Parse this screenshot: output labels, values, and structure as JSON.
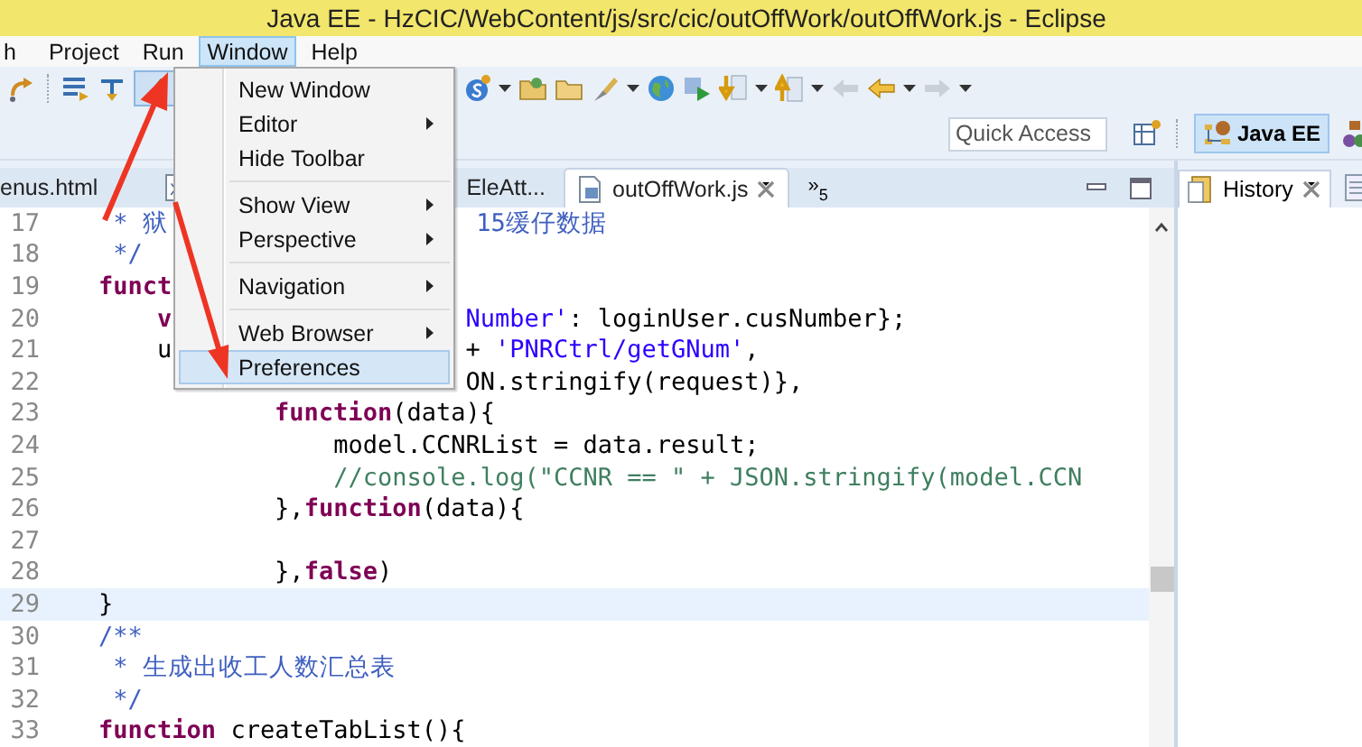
{
  "window": {
    "title": "Java EE - HzCIC/WebContent/js/src/cic/outOffWork/outOffWork.js - Eclipse"
  },
  "menu_bar": [
    {
      "label": "h",
      "selected": false
    },
    {
      "label": "Project",
      "selected": false
    },
    {
      "label": "Run",
      "selected": false
    },
    {
      "label": "Window",
      "selected": true
    },
    {
      "label": "Help",
      "selected": false
    }
  ],
  "window_menu": [
    {
      "kind": "item",
      "label": "New Window",
      "submenu": false,
      "selected": false
    },
    {
      "kind": "item",
      "label": "Editor",
      "submenu": true,
      "selected": false
    },
    {
      "kind": "item",
      "label": "Hide Toolbar",
      "submenu": false,
      "selected": false
    },
    {
      "kind": "separator"
    },
    {
      "kind": "item",
      "label": "Show View",
      "submenu": true,
      "selected": false
    },
    {
      "kind": "item",
      "label": "Perspective",
      "submenu": true,
      "selected": false
    },
    {
      "kind": "separator"
    },
    {
      "kind": "item",
      "label": "Navigation",
      "submenu": true,
      "selected": false
    },
    {
      "kind": "separator"
    },
    {
      "kind": "item",
      "label": "Web Browser",
      "submenu": true,
      "selected": false
    },
    {
      "kind": "item",
      "label": "Preferences",
      "submenu": false,
      "selected": true
    }
  ],
  "quick_access": {
    "placeholder": "Quick Access"
  },
  "perspectives": [
    {
      "label": "Java EE",
      "selected": true
    }
  ],
  "editor_tabs": [
    {
      "label": "enus.html",
      "selected": false,
      "closable": false
    },
    {
      "selected": false
    },
    {
      "label": "EleAtt...",
      "selected": false,
      "closable": false
    },
    {
      "label": "outOffWork.js",
      "selected": true,
      "closable": true
    }
  ],
  "tab_overflow": {
    "marker": "»",
    "count": "5"
  },
  "editor": {
    "lines": [
      {
        "number": "17",
        "current": false,
        "segments": [
          {
            "text": "     * 狱",
            "kind": "doc"
          },
          {
            "text": "                     15缓仔数据",
            "kind": "doc"
          }
        ]
      },
      {
        "number": "18",
        "current": false,
        "segments": [
          {
            "text": "     */",
            "kind": "doc"
          }
        ]
      },
      {
        "number": "19",
        "current": false,
        "segments": [
          {
            "text": "    funct",
            "kind": "keyword"
          }
        ]
      },
      {
        "number": "20",
        "current": false,
        "segments": [
          {
            "text": "        v",
            "kind": "keyword"
          },
          {
            "text": "                    Number'",
            "kind": "string"
          },
          {
            "text": ": loginUser.cusNumber};",
            "kind": "plain"
          }
        ]
      },
      {
        "number": "21",
        "current": false,
        "segments": [
          {
            "text": "        u",
            "kind": "plain"
          },
          {
            "text": "                    + ",
            "kind": "plain"
          },
          {
            "text": "'PNRCtrl/getGNum'",
            "kind": "string"
          },
          {
            "text": ",",
            "kind": "plain"
          }
        ]
      },
      {
        "number": "22",
        "current": false,
        "segments": [
          {
            "text": "                             ON.stringify(request)},",
            "kind": "plain"
          }
        ]
      },
      {
        "number": "23",
        "current": false,
        "segments": [
          {
            "text": "                function",
            "kind": "keyword"
          },
          {
            "text": "(data){",
            "kind": "plain"
          }
        ]
      },
      {
        "number": "24",
        "current": false,
        "segments": [
          {
            "text": "                    model.CCNRList = data.result;",
            "kind": "plain"
          }
        ]
      },
      {
        "number": "25",
        "current": false,
        "segments": [
          {
            "text": "                    //console.log(\"CCNR == \" + JSON.stringify(model.CCN",
            "kind": "comment"
          }
        ]
      },
      {
        "number": "26",
        "current": false,
        "segments": [
          {
            "text": "                },",
            "kind": "plain"
          },
          {
            "text": "function",
            "kind": "keyword"
          },
          {
            "text": "(data){",
            "kind": "plain"
          }
        ]
      },
      {
        "number": "27",
        "current": false
      },
      {
        "number": "28",
        "current": false,
        "segments": [
          {
            "text": "                },",
            "kind": "plain"
          },
          {
            "text": "false",
            "kind": "keyword"
          },
          {
            "text": ")",
            "kind": "plain"
          }
        ]
      },
      {
        "number": "29",
        "current": true,
        "segments": [
          {
            "text": "    }",
            "kind": "plain"
          }
        ]
      },
      {
        "number": "30",
        "current": false,
        "segments": [
          {
            "text": "    /**",
            "kind": "doc"
          }
        ]
      },
      {
        "number": "31",
        "current": false,
        "segments": [
          {
            "text": "     * 生成出收工人数汇总表",
            "kind": "doc"
          }
        ]
      },
      {
        "number": "32",
        "current": false,
        "segments": [
          {
            "text": "     */",
            "kind": "doc"
          }
        ]
      },
      {
        "number": "33",
        "current": false,
        "segments": [
          {
            "text": "    function",
            "kind": "keyword"
          },
          {
            "text": " createTabList(){",
            "kind": "plain"
          }
        ]
      }
    ]
  },
  "side_view": {
    "tabs": [
      {
        "label": "History",
        "selected": true
      }
    ]
  }
}
